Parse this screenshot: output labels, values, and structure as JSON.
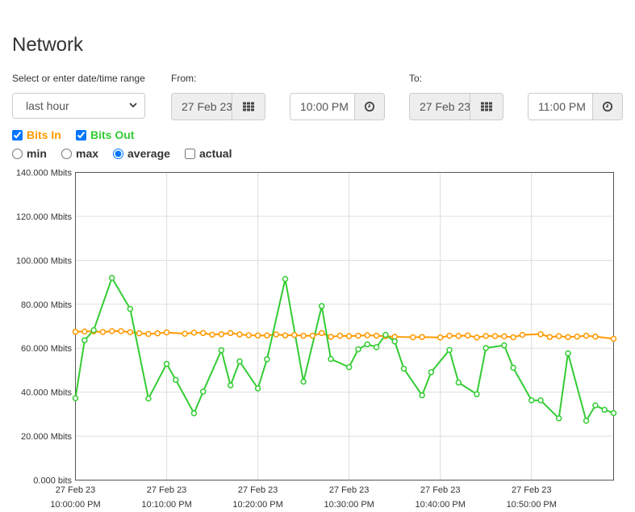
{
  "page": {
    "title": "Network"
  },
  "range": {
    "label": "Select or enter date/time range",
    "value": "last hour"
  },
  "from": {
    "label": "From:",
    "date": "27 Feb 23",
    "time": "10:00 PM"
  },
  "to": {
    "label": "To:",
    "date": "27 Feb 23",
    "time": "11:00 PM"
  },
  "series_toggles": [
    {
      "label": "Bits In",
      "checked": true,
      "color": "#ff9900"
    },
    {
      "label": "Bits Out",
      "checked": true,
      "color": "#33cc33"
    }
  ],
  "modes": [
    {
      "label": "min",
      "selected": false
    },
    {
      "label": "max",
      "selected": false
    },
    {
      "label": "average",
      "selected": true
    },
    {
      "label": "actual",
      "selected": false,
      "kind": "checkbox"
    }
  ],
  "chart_data": {
    "type": "line",
    "yunit": "Mbits",
    "ylim": [
      0,
      140
    ],
    "yticks": [
      "0.000 bits",
      "20.000 Mbits",
      "40.000 Mbits",
      "60.000 Mbits",
      "80.000 Mbits",
      "100.000 Mbits",
      "120.000 Mbits",
      "140.000 Mbits"
    ],
    "xlim": [
      0,
      59
    ],
    "xticks": [
      {
        "at": 0,
        "line1": "27 Feb 23",
        "line2": "10:00:00 PM"
      },
      {
        "at": 10,
        "line1": "27 Feb 23",
        "line2": "10:10:00 PM"
      },
      {
        "at": 20,
        "line1": "27 Feb 23",
        "line2": "10:20:00 PM"
      },
      {
        "at": 30,
        "line1": "27 Feb 23",
        "line2": "10:30:00 PM"
      },
      {
        "at": 40,
        "line1": "27 Feb 23",
        "line2": "10:40:00 PM"
      },
      {
        "at": 50,
        "line1": "27 Feb 23",
        "line2": "10:50:00 PM"
      }
    ],
    "grid": true,
    "series": [
      {
        "name": "Bits In",
        "color": "#ff9900",
        "points": [
          [
            0,
            67.5
          ],
          [
            1,
            67.6
          ],
          [
            2,
            67.7
          ],
          [
            3,
            67.4
          ],
          [
            4,
            67.8
          ],
          [
            5,
            67.8
          ],
          [
            6,
            67.3
          ],
          [
            7,
            66.8
          ],
          [
            8,
            66.5
          ],
          [
            9,
            66.8
          ],
          [
            10,
            67.2
          ],
          [
            12,
            66.6
          ],
          [
            13,
            67.1
          ],
          [
            14,
            66.9
          ],
          [
            15,
            66.2
          ],
          [
            16,
            66.4
          ],
          [
            17,
            66.9
          ],
          [
            18,
            66.3
          ],
          [
            19,
            65.9
          ],
          [
            20,
            65.8
          ],
          [
            21,
            65.8
          ],
          [
            22,
            66.3
          ],
          [
            23,
            65.8
          ],
          [
            24,
            66.0
          ],
          [
            25,
            65.7
          ],
          [
            26,
            65.7
          ],
          [
            27,
            66.9
          ],
          [
            28,
            65.2
          ],
          [
            29,
            65.7
          ],
          [
            30,
            65.5
          ],
          [
            31,
            65.7
          ],
          [
            32,
            65.9
          ],
          [
            33,
            65.7
          ],
          [
            34,
            65.5
          ],
          [
            35,
            65.2
          ],
          [
            37,
            65.0
          ],
          [
            38,
            65.1
          ],
          [
            40,
            64.9
          ],
          [
            41,
            65.7
          ],
          [
            42,
            65.6
          ],
          [
            43,
            65.8
          ],
          [
            44,
            64.9
          ],
          [
            45,
            65.6
          ],
          [
            46,
            65.5
          ],
          [
            47,
            65.4
          ],
          [
            48,
            65.0
          ],
          [
            49,
            66.1
          ],
          [
            51,
            66.4
          ],
          [
            52,
            65.1
          ],
          [
            53,
            65.5
          ],
          [
            54,
            65.1
          ],
          [
            55,
            65.3
          ],
          [
            56,
            65.7
          ],
          [
            57,
            65.3
          ],
          [
            59,
            64.3
          ]
        ]
      },
      {
        "name": "Bits Out",
        "color": "#33cc33",
        "points": [
          [
            0,
            37.3
          ],
          [
            1,
            63.6
          ],
          [
            2,
            68.2
          ],
          [
            4,
            92.0
          ],
          [
            6,
            77.9
          ],
          [
            8,
            37.1
          ],
          [
            10,
            52.9
          ],
          [
            11,
            45.6
          ],
          [
            13,
            30.4
          ],
          [
            14,
            40.3
          ],
          [
            16,
            59.1
          ],
          [
            17,
            43.1
          ],
          [
            18,
            54.0
          ],
          [
            20,
            41.7
          ],
          [
            21,
            55.0
          ],
          [
            23,
            91.5
          ],
          [
            25,
            44.8
          ],
          [
            27,
            79.2
          ],
          [
            28,
            55.1
          ],
          [
            30,
            51.4
          ],
          [
            31,
            59.5
          ],
          [
            32,
            61.8
          ],
          [
            33,
            60.5
          ],
          [
            34,
            66.1
          ],
          [
            35,
            63.1
          ],
          [
            36,
            50.7
          ],
          [
            38,
            38.6
          ],
          [
            39,
            49.1
          ],
          [
            41,
            59.2
          ],
          [
            42,
            44.4
          ],
          [
            44,
            39.1
          ],
          [
            45,
            60.1
          ],
          [
            47,
            61.3
          ],
          [
            48,
            51.1
          ],
          [
            50,
            36.3
          ],
          [
            51,
            36.3
          ],
          [
            53,
            28.1
          ],
          [
            54,
            57.7
          ],
          [
            56,
            27.0
          ],
          [
            57,
            34.0
          ],
          [
            58,
            32.0
          ],
          [
            59,
            30.5
          ]
        ]
      }
    ]
  }
}
